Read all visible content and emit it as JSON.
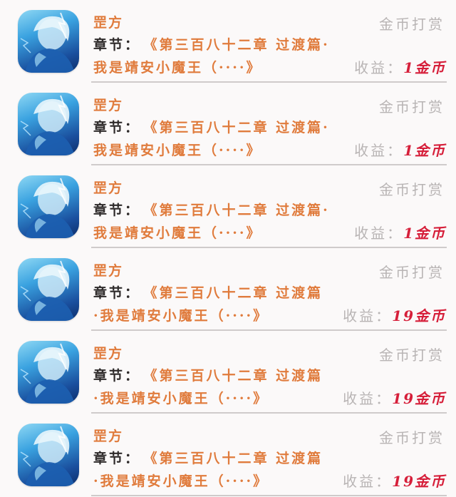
{
  "rewards": [
    {
      "user_name": "罡方",
      "action_label": "金币打赏",
      "chapter_label": "章节：",
      "chapter_line1": "《第三百八十二章 过渡篇·",
      "chapter_line2": "我是靖安小魔王（····》",
      "income_label": "收益：",
      "income_value": "1金币",
      "avatar_icon": "anime-avatar-icon"
    },
    {
      "user_name": "罡方",
      "action_label": "金币打赏",
      "chapter_label": "章节：",
      "chapter_line1": "《第三百八十二章 过渡篇·",
      "chapter_line2": "我是靖安小魔王（····》",
      "income_label": "收益：",
      "income_value": "1金币",
      "avatar_icon": "anime-avatar-icon"
    },
    {
      "user_name": "罡方",
      "action_label": "金币打赏",
      "chapter_label": "章节：",
      "chapter_line1": "《第三百八十二章 过渡篇·",
      "chapter_line2": "我是靖安小魔王（····》",
      "income_label": "收益：",
      "income_value": "1金币",
      "avatar_icon": "anime-avatar-icon"
    },
    {
      "user_name": "罡方",
      "action_label": "金币打赏",
      "chapter_label": "章节：",
      "chapter_line1": "《第三百八十二章 过渡篇",
      "chapter_line2": "·我是靖安小魔王（····》",
      "income_label": "收益：",
      "income_value": "19金币",
      "avatar_icon": "anime-avatar-icon"
    },
    {
      "user_name": "罡方",
      "action_label": "金币打赏",
      "chapter_label": "章节：",
      "chapter_line1": "《第三百八十二章 过渡篇",
      "chapter_line2": "·我是靖安小魔王（····》",
      "income_label": "收益：",
      "income_value": "19金币",
      "avatar_icon": "anime-avatar-icon"
    },
    {
      "user_name": "罡方",
      "action_label": "金币打赏",
      "chapter_label": "章节：",
      "chapter_line1": "《第三百八十二章 过渡篇",
      "chapter_line2": "·我是靖安小魔王（····》",
      "income_label": "收益：",
      "income_value": "19金币",
      "avatar_icon": "anime-avatar-icon"
    }
  ],
  "colors": {
    "name": "#e07b3c",
    "muted": "#b8b4b4",
    "income": "#d61f3a",
    "avatar_blue": "#3aa2e0"
  }
}
